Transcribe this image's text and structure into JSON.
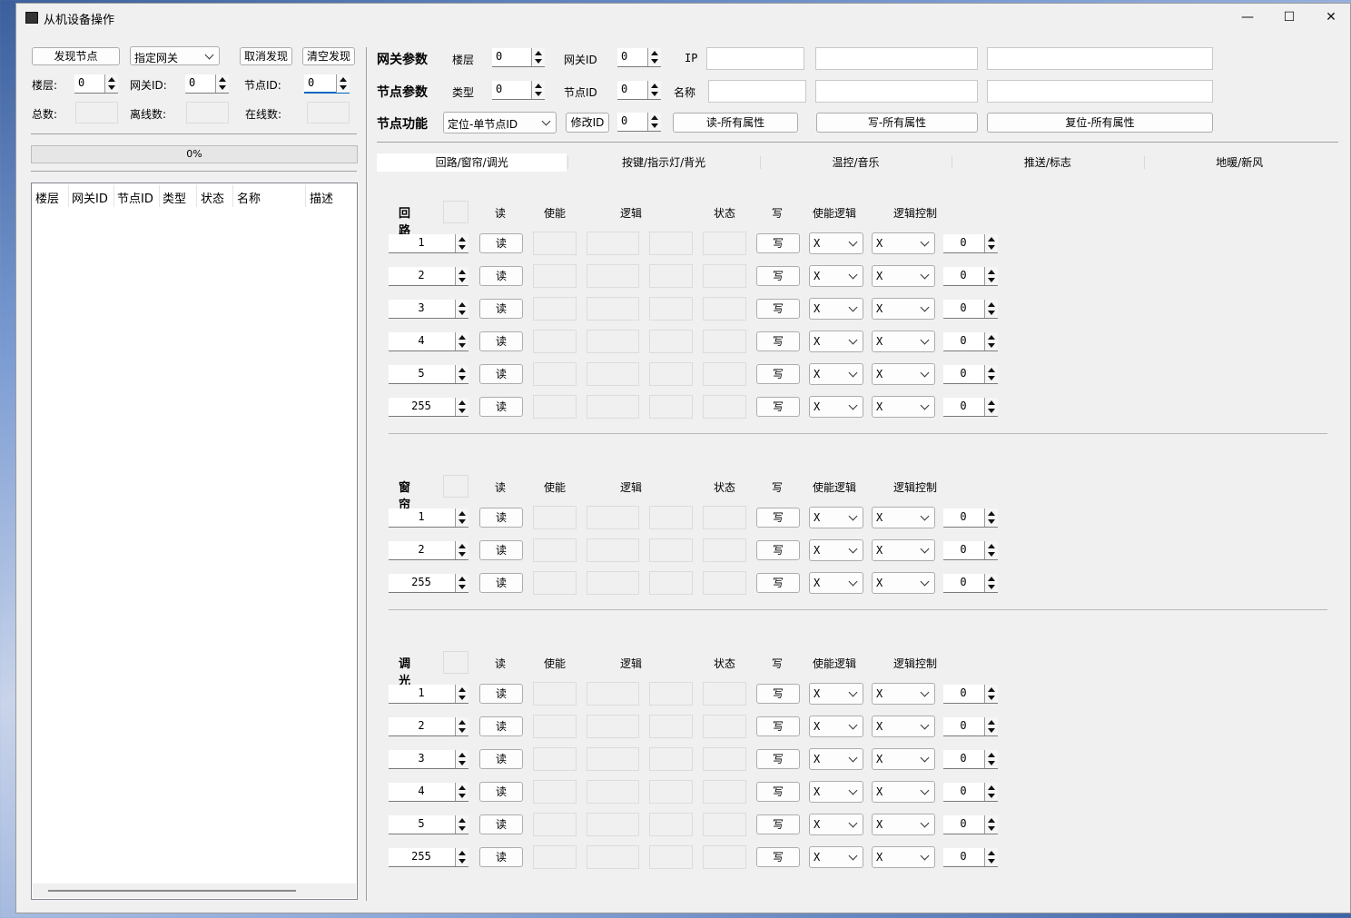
{
  "window": {
    "title": "从机设备操作",
    "minimize": "—",
    "maximize": "☐",
    "close": "✕"
  },
  "left": {
    "discover_btn": "发现节点",
    "gateway_mode": "指定网关",
    "cancel_btn": "取消发现",
    "clear_btn": "清空发现",
    "floor_label": "楼层:",
    "floor_value": "0",
    "gateway_id_label": "网关ID:",
    "gateway_id_value": "0",
    "node_id_label": "节点ID:",
    "node_id_value": "0",
    "total_label": "总数:",
    "offline_label": "离线数:",
    "online_label": "在线数:",
    "progress": "0%",
    "progress_fraction": 0,
    "columns": [
      "楼层",
      "网关ID",
      "节点ID",
      "类型",
      "状态",
      "名称",
      "描述"
    ]
  },
  "params": {
    "gateway_title": "网关参数",
    "floor_label": "楼层",
    "floor_value": "0",
    "gateway_id_label": "网关ID",
    "gateway_id_value": "0",
    "ip_label": "IP",
    "node_title": "节点参数",
    "type_label": "类型",
    "type_value": "0",
    "node_id_label": "节点ID",
    "node_id_value": "0",
    "name_label": "名称",
    "func_title": "节点功能",
    "func_mode": "定位-单节点ID",
    "modify_btn": "修改ID",
    "modify_value": "0",
    "read_all": "读-所有属性",
    "write_all": "写-所有属性",
    "reset_all": "复位-所有属性"
  },
  "tabs": [
    "回路/窗帘/调光",
    "按键/指示灯/背光",
    "温控/音乐",
    "推送/标志",
    "地暖/新风"
  ],
  "headers": {
    "read": "读",
    "enable": "使能",
    "logic": "逻辑",
    "state": "状态",
    "write": "写",
    "enable_logic": "使能逻辑",
    "logic_control": "逻辑控制"
  },
  "sections": [
    {
      "title": "回路",
      "channels": [
        "1",
        "2",
        "3",
        "4",
        "5",
        "255"
      ]
    },
    {
      "title": "窗帘",
      "channels": [
        "1",
        "2",
        "255"
      ]
    },
    {
      "title": "调光",
      "channels": [
        "1",
        "2",
        "3",
        "4",
        "5",
        "255"
      ]
    }
  ],
  "row_defaults": {
    "read_btn": "读",
    "write_btn": "写",
    "enable_logic": "X",
    "logic_control": "X",
    "value": "0"
  }
}
